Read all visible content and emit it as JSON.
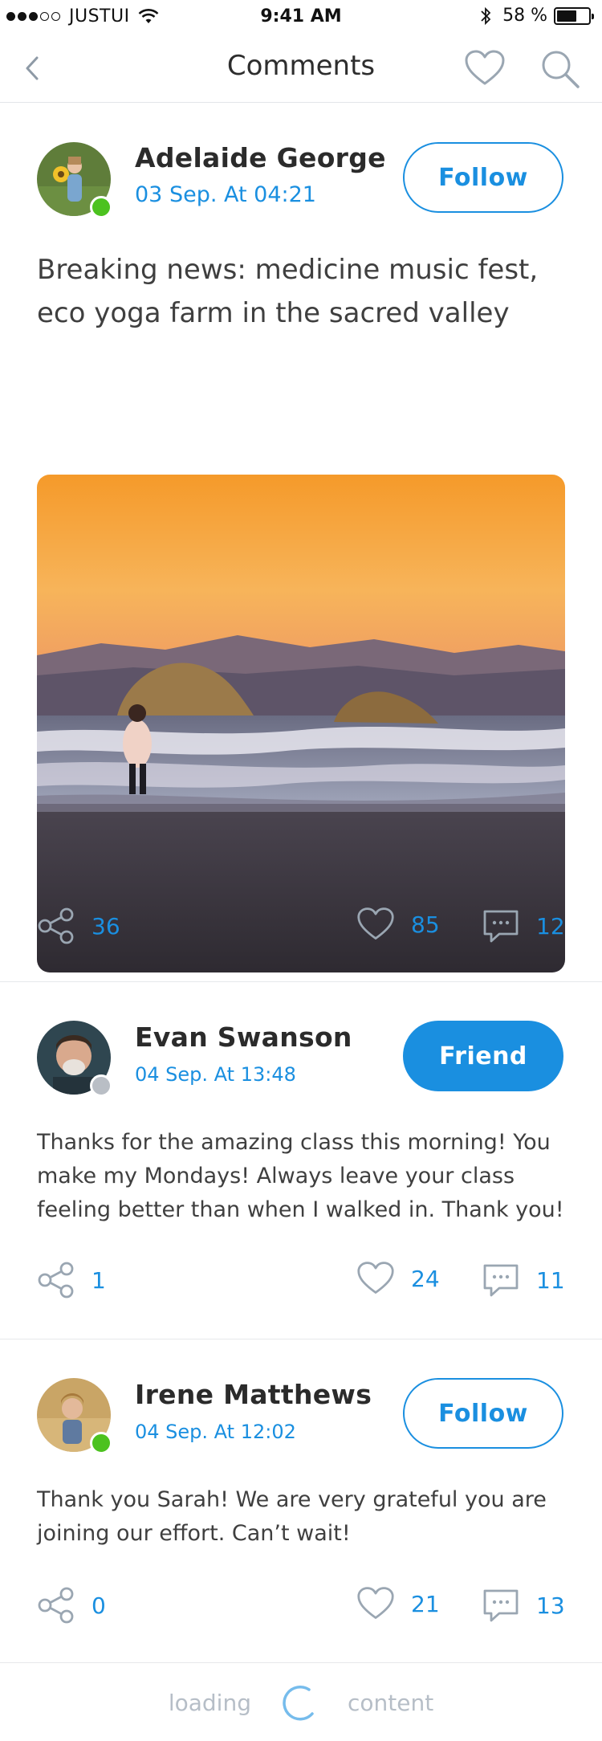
{
  "status_bar": {
    "carrier": "JUSTUI",
    "time": "9:41 AM",
    "battery": "58 %",
    "battery_level": 0.58
  },
  "nav": {
    "title": "Comments"
  },
  "posts": [
    {
      "author": "Adelaide George",
      "date": "03 Sep. At 04:21",
      "button": "Follow",
      "button_style": "outline",
      "online_color": "#4cc21f",
      "text": "Breaking news: medicine music fest, eco yoga farm in the sacred valley",
      "has_photo": true,
      "shares": "36",
      "likes": "85",
      "comments": "12"
    },
    {
      "author": "Evan Swanson",
      "date": "04 Sep. At 13:48",
      "button": "Friend",
      "button_style": "solid",
      "online_color": "#b9bec5",
      "text": "Thanks for the amazing class this morning! You make my Mondays! Always leave your class feeling better than when I walked in. Thank you!",
      "shares": "1",
      "likes": "24",
      "comments": "11"
    },
    {
      "author": "Irene Matthews",
      "date": "04 Sep. At 12:02",
      "button": "Follow",
      "button_style": "outline",
      "online_color": "#4cc21f",
      "text": "Thank you Sarah! We are very grateful you are joining our effort. Can’t wait!",
      "shares": "0",
      "likes": "21",
      "comments": "13"
    }
  ],
  "loading": {
    "left": "loading",
    "right": "content"
  },
  "colors": {
    "accent": "#1a8fe0",
    "online": "#4cc21f",
    "offline": "#b9bec5"
  }
}
